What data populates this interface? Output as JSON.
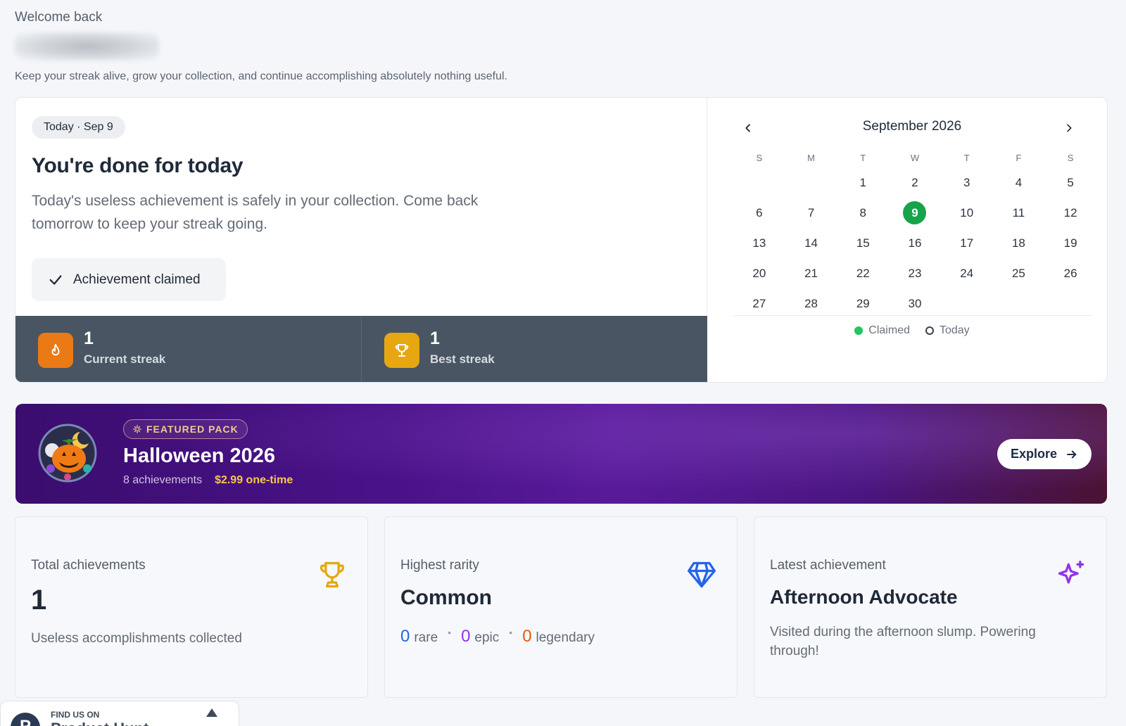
{
  "header": {
    "welcome": "Welcome back",
    "tagline": "Keep your streak alive, grow your collection, and continue accomplishing absolutely nothing useful."
  },
  "today": {
    "date_chip": "Today · Sep 9",
    "title": "You're done for today",
    "description": "Today's useless achievement is safely in your collection. Come back tomorrow to keep your streak going.",
    "claimed_label": "Achievement claimed"
  },
  "streaks": [
    {
      "value": "1",
      "label": "Current streak",
      "icon": "flame-icon",
      "color": "#ea7a16"
    },
    {
      "value": "1",
      "label": "Best streak",
      "icon": "trophy-icon",
      "color": "#e6a711"
    }
  ],
  "calendar": {
    "month": "September 2026",
    "weekdays": [
      "S",
      "M",
      "T",
      "W",
      "T",
      "F",
      "S"
    ],
    "weeks": [
      [
        "",
        "",
        "1",
        "2",
        "3",
        "4",
        "5"
      ],
      [
        "6",
        "7",
        "8",
        "9",
        "10",
        "11",
        "12"
      ],
      [
        "13",
        "14",
        "15",
        "16",
        "17",
        "18",
        "19"
      ],
      [
        "20",
        "21",
        "22",
        "23",
        "24",
        "25",
        "26"
      ],
      [
        "27",
        "28",
        "29",
        "30",
        "",
        "",
        ""
      ]
    ],
    "claimed_day": "9",
    "legend_claimed": "Claimed",
    "legend_today": "Today",
    "claimed_color": "#16a34a"
  },
  "featured": {
    "chip": "FEATURED PACK",
    "title": "Halloween 2026",
    "count": "8 achievements",
    "price": "$2.99 one-time",
    "explore": "Explore"
  },
  "cards": {
    "total": {
      "label": "Total achievements",
      "value": "1",
      "sub": "Useless accomplishments collected",
      "icon": "trophy-icon"
    },
    "rarity": {
      "label": "Highest rarity",
      "value": "Common",
      "rare_count": "0",
      "rare_label": "rare",
      "epic_count": "0",
      "epic_label": "epic",
      "legendary_count": "0",
      "legendary_label": "legendary",
      "icon": "gem-icon"
    },
    "latest": {
      "label": "Latest achievement",
      "value": "Afternoon Advocate",
      "description": "Visited during the afternoon slump. Powering through!",
      "icon": "sparkle-icon"
    }
  },
  "widget": {
    "find_us": "FIND US ON",
    "name": "Product Hunt"
  },
  "colors": {
    "accent_green": "#16a34a",
    "rare": "#2563eb",
    "epic": "#9333ea",
    "legendary": "#ea580c",
    "banner_purple": "#4a1289"
  }
}
